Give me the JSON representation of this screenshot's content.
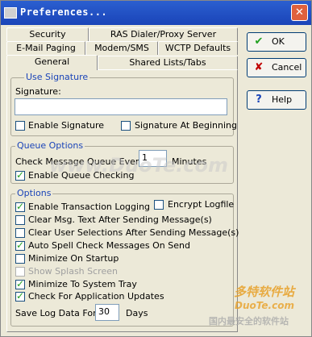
{
  "window": {
    "title": "Preferences..."
  },
  "tabs": {
    "row1": [
      "Security",
      "RAS Dialer/Proxy Server"
    ],
    "row2": [
      "E-Mail Paging",
      "Modem/SMS",
      "WCTP Defaults"
    ],
    "row3": [
      "General",
      "Shared Lists/Tabs"
    ],
    "active": "General"
  },
  "signature_group": {
    "legend": "Use Signature",
    "signature_label": "Signature:",
    "signature_value": "",
    "enable_signature": {
      "label": "Enable Signature",
      "checked": false
    },
    "signature_at_beginning": {
      "label": "Signature At Beginning",
      "checked": false
    }
  },
  "queue_group": {
    "legend": "Queue Options",
    "check_every_label": "Check Message Queue Every",
    "check_every_value": "1",
    "minutes_label": "Minutes",
    "enable_queue_checking": {
      "label": "Enable Queue Checking",
      "checked": true
    }
  },
  "options_group": {
    "legend": "Options",
    "items": [
      {
        "label": "Enable Transaction Logging",
        "checked": true,
        "disabled": false
      },
      {
        "label": "Clear Msg. Text After Sending Message(s)",
        "checked": false,
        "disabled": false
      },
      {
        "label": "Clear User Selections After Sending Message(s)",
        "checked": false,
        "disabled": false
      },
      {
        "label": "Auto Spell Check Messages On Send",
        "checked": true,
        "disabled": false
      },
      {
        "label": "Minimize On Startup",
        "checked": false,
        "disabled": false
      },
      {
        "label": "Show Splash Screen",
        "checked": false,
        "disabled": true
      },
      {
        "label": "Minimize To System Tray",
        "checked": true,
        "disabled": false
      },
      {
        "label": "Check For Application Updates",
        "checked": true,
        "disabled": false
      }
    ],
    "encrypt_logfile": {
      "label": "Encrypt Logfile",
      "checked": false
    },
    "save_log_label": "Save Log Data For",
    "save_log_value": "30",
    "days_label": "Days"
  },
  "buttons": {
    "ok": "OK",
    "cancel": "Cancel",
    "help": "Help"
  },
  "watermarks": {
    "center": "www.DuoTe.com",
    "brand_cn": "多特软件站",
    "brand_url": "DuoTe.com",
    "tagline_cn": "国内最安全的软件站"
  },
  "colors": {
    "titlebar": "#1a44b8",
    "legend": "#1a44b8",
    "check": "#21a121"
  }
}
